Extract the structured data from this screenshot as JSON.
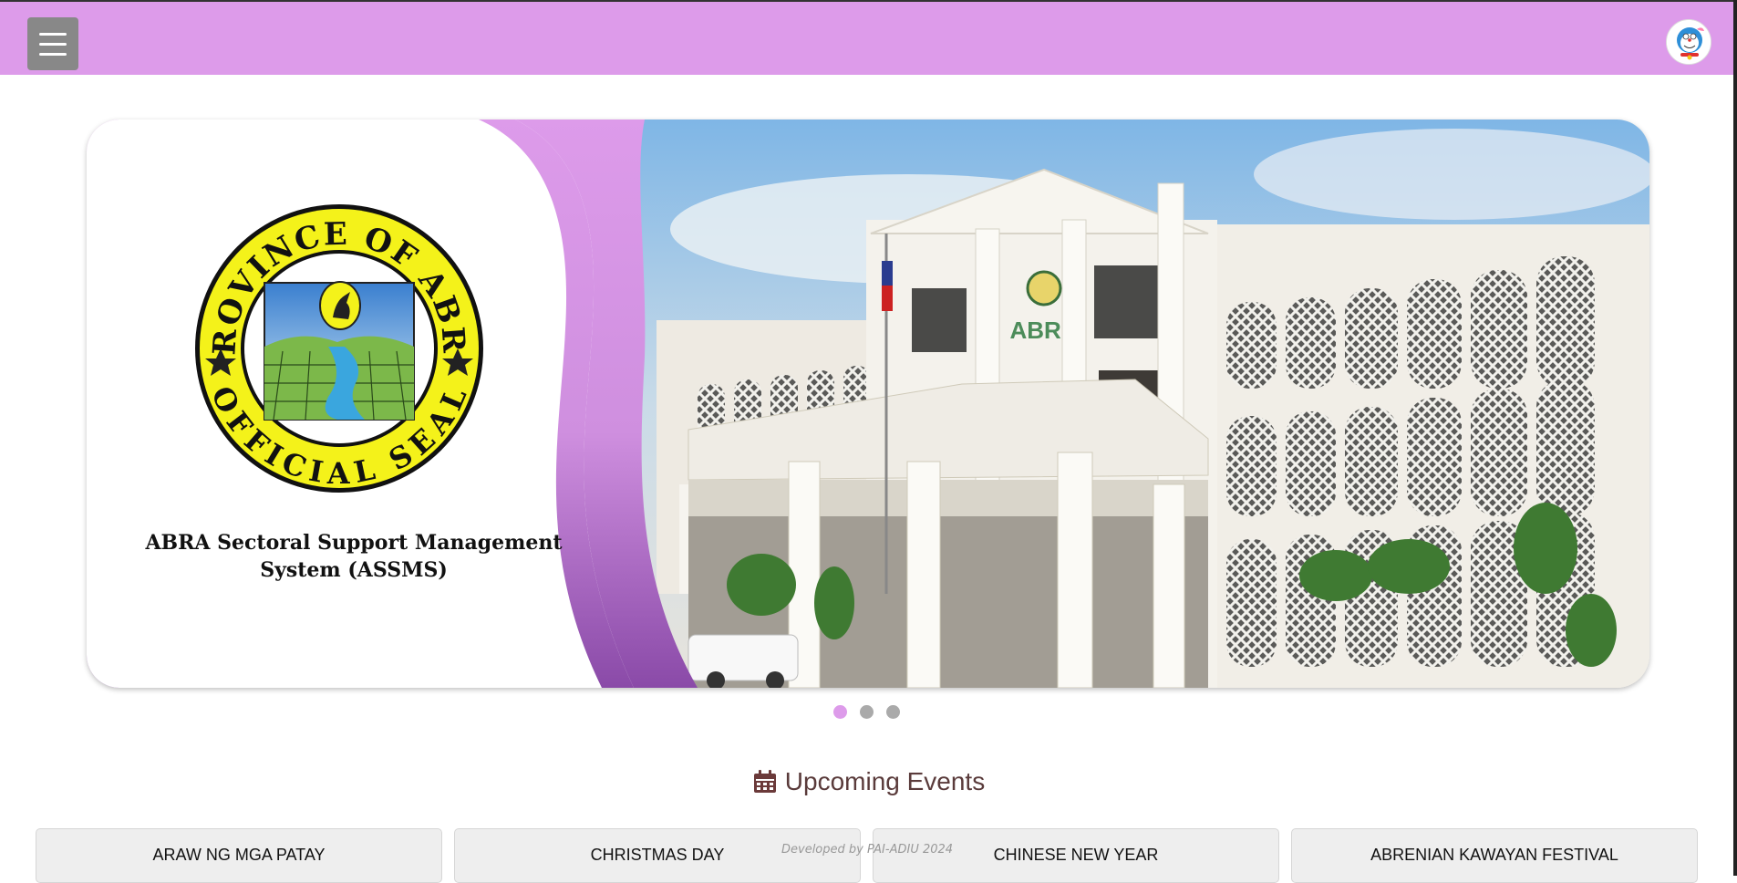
{
  "header": {
    "menu_icon": "hamburger-icon",
    "avatar_icon": "user-avatar",
    "bar_color": "#dd9bea"
  },
  "hero": {
    "seal_top_text": "PROVINCE OF ABRA",
    "seal_bottom_text": "OFFICIAL SEAL",
    "title": "ABRA Sectoral Support Management System (ASSMS)",
    "building_sign": "ABRA",
    "accent_color": "#dd9bea"
  },
  "carousel": {
    "slide_count": 3,
    "active_index": 0
  },
  "events": {
    "icon": "calendar-icon",
    "title": "Upcoming Events",
    "items": [
      {
        "label": "ARAW NG MGA PATAY"
      },
      {
        "label": "CHRISTMAS DAY"
      },
      {
        "label": "CHINESE NEW YEAR"
      },
      {
        "label": "ABRENIAN KAWAYAN FESTIVAL"
      }
    ]
  },
  "footer": {
    "credit": "Developed by PAI-ADIU 2024"
  }
}
